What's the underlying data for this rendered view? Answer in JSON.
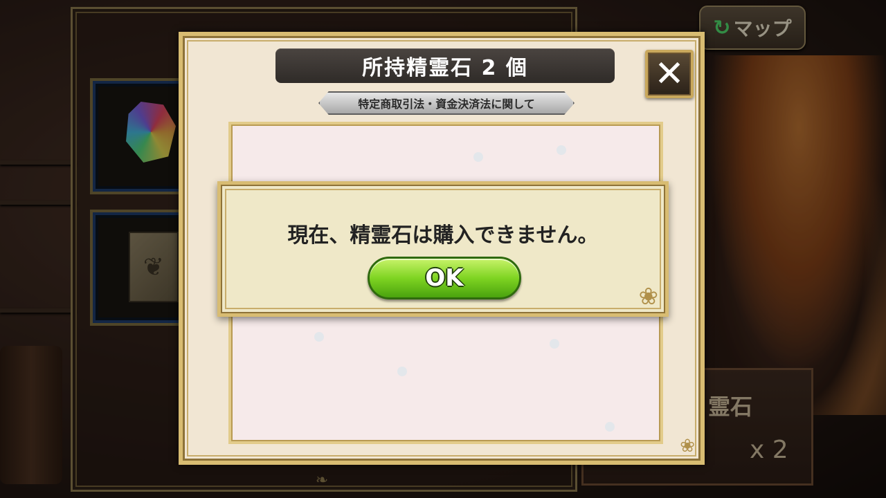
{
  "background": {
    "map_button_label": "マップ",
    "map_icon": "refresh-arrow-icon",
    "stone_label": "霊石",
    "stone_count": "x 2",
    "book_icon": "lotus-crest-icon",
    "gem_icon": "rainbow-spirit-stone-icon"
  },
  "dialog": {
    "title": "所持精霊石 2 個",
    "legal_link": "特定商取引法・資金決済法に関して",
    "close_icon": "close-x-icon"
  },
  "alert": {
    "message": "現在、精霊石は購入できません。",
    "ok_label": "OK"
  },
  "colors": {
    "frame_gold": "#d8bc72",
    "dialog_bg": "#f1e6d3",
    "ok_green": "#7fd422",
    "title_bar": "#2f2b28"
  }
}
